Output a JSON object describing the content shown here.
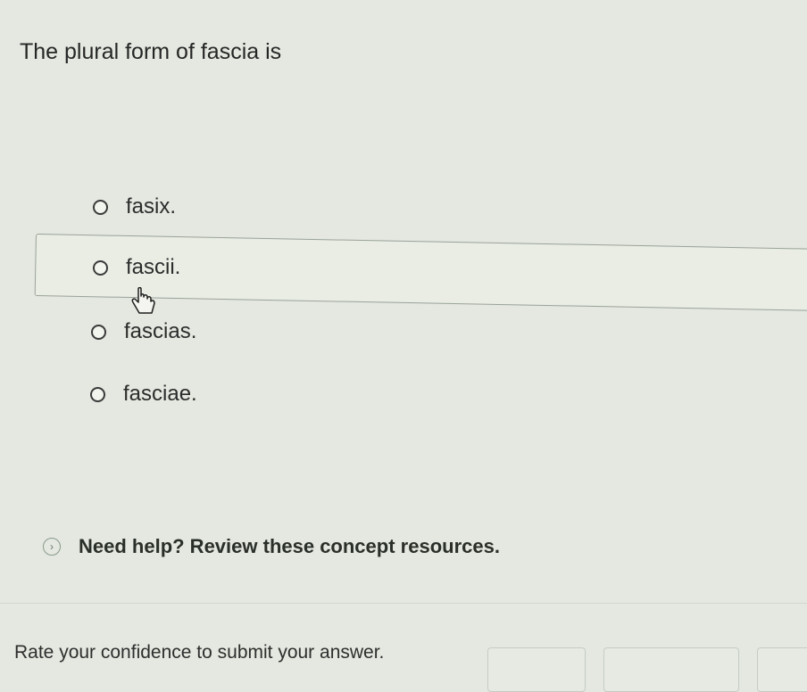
{
  "question": {
    "text": "The plural form of fascia is"
  },
  "options": [
    {
      "label": "fasix."
    },
    {
      "label": "fascii."
    },
    {
      "label": "fascias."
    },
    {
      "label": "fasciae."
    }
  ],
  "help": {
    "icon": "chevron-right-icon",
    "text": "Need help? Review these concept resources."
  },
  "confidence": {
    "prompt": "Rate your confidence to submit your answer."
  },
  "colors": {
    "background": "#e4e8e0",
    "text": "#2b2b2b",
    "highlight_border": "#9aa29a"
  }
}
